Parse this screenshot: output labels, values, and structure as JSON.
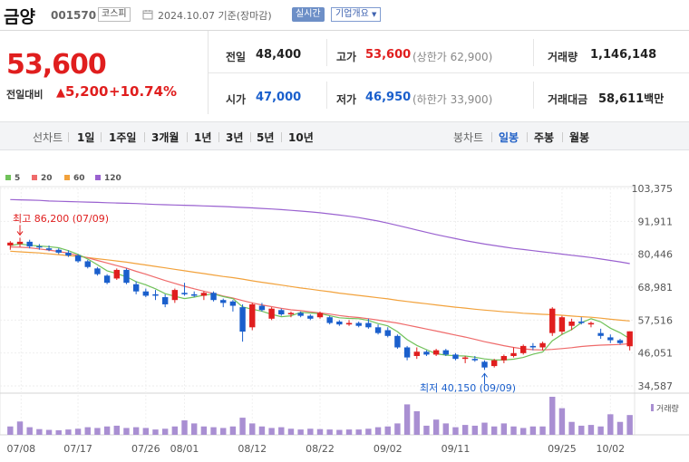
{
  "header": {
    "stock_name": "금양",
    "stock_code": "001570",
    "market": "코스피",
    "date": "2024.10.07 기준(장마감)",
    "realtime_label": "실시간",
    "company_label": "기업개요"
  },
  "price": {
    "current": "53,600",
    "change_label": "전일대비",
    "change_amount": "5,200",
    "change_percent": "+10.74%"
  },
  "stats": {
    "prev_close_label": "전일",
    "prev_close": "48,400",
    "high_label": "고가",
    "high": "53,600",
    "upper_limit": "(상한가 62,900)",
    "volume_label": "거래량",
    "volume": "1,146,148",
    "open_label": "시가",
    "open": "47,000",
    "low_label": "저가",
    "low": "46,950",
    "lower_limit": "(하한가 33,900)",
    "amount_label": "거래대금",
    "amount": "58,611",
    "amount_unit": "백만"
  },
  "toolbar": {
    "line_chart_label": "선차트",
    "periods": [
      "1일",
      "1주일",
      "3개월",
      "1년",
      "3년",
      "5년",
      "10년"
    ],
    "candle_label": "봉차트",
    "candles": [
      "일봉",
      "주봉",
      "월봉"
    ],
    "active_candle": "일봉"
  },
  "colors": {
    "up": "#e01e1e",
    "down": "#1a5fcc",
    "ma5": "#70c25a",
    "ma20": "#ef6b6b",
    "ma60": "#f2a23c",
    "ma120": "#9a62d0",
    "volume": "#a98fd2"
  },
  "chart_data": {
    "type": "candlestick",
    "legend": [
      "5",
      "20",
      "60",
      "120"
    ],
    "y_ticks": [
      "103,375",
      "91,911",
      "80,446",
      "68,981",
      "57,516",
      "46,051",
      "34,587"
    ],
    "ylim": [
      34587,
      103375
    ],
    "x_ticks": [
      "07/08",
      "07/17",
      "07/26",
      "08/01",
      "08/12",
      "08/22",
      "09/02",
      "09/11",
      "09/25",
      "10/02"
    ],
    "volume_label": "거래량",
    "annotations": {
      "high": {
        "label": "최고 86,200 (07/09)",
        "value": 86200,
        "index": 1
      },
      "low": {
        "label": "최저 40,150 (09/09)",
        "value": 40150,
        "index": 49
      }
    },
    "candles": [
      {
        "o": 83500,
        "h": 85000,
        "l": 82000,
        "c": 84500
      },
      {
        "o": 84000,
        "h": 86200,
        "l": 83000,
        "c": 84800
      },
      {
        "o": 84800,
        "h": 85500,
        "l": 82500,
        "c": 83200
      },
      {
        "o": 83200,
        "h": 84000,
        "l": 82000,
        "c": 82800
      },
      {
        "o": 82500,
        "h": 83500,
        "l": 81500,
        "c": 82000
      },
      {
        "o": 82000,
        "h": 82500,
        "l": 80500,
        "c": 81000
      },
      {
        "o": 81000,
        "h": 81800,
        "l": 79500,
        "c": 80000
      },
      {
        "o": 80000,
        "h": 80500,
        "l": 77500,
        "c": 78000
      },
      {
        "o": 78000,
        "h": 78500,
        "l": 75500,
        "c": 76000
      },
      {
        "o": 75500,
        "h": 76000,
        "l": 73000,
        "c": 73500
      },
      {
        "o": 73000,
        "h": 73500,
        "l": 70000,
        "c": 70500
      },
      {
        "o": 72000,
        "h": 75500,
        "l": 71500,
        "c": 75000
      },
      {
        "o": 75000,
        "h": 75500,
        "l": 70000,
        "c": 70500
      },
      {
        "o": 70000,
        "h": 71000,
        "l": 66500,
        "c": 67500
      },
      {
        "o": 67500,
        "h": 68500,
        "l": 65500,
        "c": 66000
      },
      {
        "o": 66500,
        "h": 68000,
        "l": 64500,
        "c": 66000
      },
      {
        "o": 65500,
        "h": 66500,
        "l": 62000,
        "c": 63000
      },
      {
        "o": 64500,
        "h": 68500,
        "l": 63500,
        "c": 68000
      },
      {
        "o": 67000,
        "h": 70500,
        "l": 66000,
        "c": 66500
      },
      {
        "o": 66500,
        "h": 67500,
        "l": 65500,
        "c": 66000
      },
      {
        "o": 66000,
        "h": 67500,
        "l": 64500,
        "c": 67000
      },
      {
        "o": 67000,
        "h": 67500,
        "l": 64000,
        "c": 64500
      },
      {
        "o": 64500,
        "h": 65000,
        "l": 62000,
        "c": 63500
      },
      {
        "o": 64000,
        "h": 64500,
        "l": 60500,
        "c": 62500
      },
      {
        "o": 62000,
        "h": 63000,
        "l": 50000,
        "c": 53500
      },
      {
        "o": 55000,
        "h": 63500,
        "l": 54000,
        "c": 63000
      },
      {
        "o": 62500,
        "h": 63500,
        "l": 60500,
        "c": 61000
      },
      {
        "o": 58000,
        "h": 62000,
        "l": 57500,
        "c": 61500
      },
      {
        "o": 61000,
        "h": 61500,
        "l": 59000,
        "c": 59500
      },
      {
        "o": 59500,
        "h": 60500,
        "l": 58500,
        "c": 60000
      },
      {
        "o": 60000,
        "h": 60500,
        "l": 58500,
        "c": 59000
      },
      {
        "o": 59000,
        "h": 59500,
        "l": 57500,
        "c": 58000
      },
      {
        "o": 58500,
        "h": 60500,
        "l": 58000,
        "c": 60000
      },
      {
        "o": 58500,
        "h": 59000,
        "l": 56000,
        "c": 56500
      },
      {
        "o": 57000,
        "h": 57500,
        "l": 55500,
        "c": 56000
      },
      {
        "o": 56000,
        "h": 57500,
        "l": 55500,
        "c": 56500
      },
      {
        "o": 56500,
        "h": 57000,
        "l": 55000,
        "c": 55500
      },
      {
        "o": 56500,
        "h": 58000,
        "l": 54500,
        "c": 55000
      },
      {
        "o": 55000,
        "h": 56000,
        "l": 52500,
        "c": 53000
      },
      {
        "o": 54000,
        "h": 55000,
        "l": 51500,
        "c": 52000
      },
      {
        "o": 52000,
        "h": 52500,
        "l": 47500,
        "c": 48000
      },
      {
        "o": 48000,
        "h": 48500,
        "l": 43500,
        "c": 44500
      },
      {
        "o": 45000,
        "h": 48000,
        "l": 44000,
        "c": 46500
      },
      {
        "o": 46500,
        "h": 47000,
        "l": 45000,
        "c": 45500
      },
      {
        "o": 45500,
        "h": 47500,
        "l": 45000,
        "c": 47000
      },
      {
        "o": 47000,
        "h": 47500,
        "l": 45000,
        "c": 45500
      },
      {
        "o": 45500,
        "h": 46000,
        "l": 43500,
        "c": 44000
      },
      {
        "o": 44000,
        "h": 45000,
        "l": 42500,
        "c": 44500
      },
      {
        "o": 44000,
        "h": 45000,
        "l": 43000,
        "c": 43500
      },
      {
        "o": 43000,
        "h": 43500,
        "l": 40150,
        "c": 41000
      },
      {
        "o": 41500,
        "h": 44000,
        "l": 41000,
        "c": 43500
      },
      {
        "o": 43500,
        "h": 45500,
        "l": 42500,
        "c": 45000
      },
      {
        "o": 45000,
        "h": 48000,
        "l": 44500,
        "c": 46000
      },
      {
        "o": 46000,
        "h": 49000,
        "l": 45500,
        "c": 48500
      },
      {
        "o": 48500,
        "h": 49500,
        "l": 47000,
        "c": 48000
      },
      {
        "o": 48000,
        "h": 50000,
        "l": 47000,
        "c": 49500
      },
      {
        "o": 53000,
        "h": 62000,
        "l": 52000,
        "c": 61500
      },
      {
        "o": 53500,
        "h": 59000,
        "l": 52500,
        "c": 58500
      },
      {
        "o": 55500,
        "h": 58000,
        "l": 54000,
        "c": 57000
      },
      {
        "o": 57000,
        "h": 58500,
        "l": 56000,
        "c": 56500
      },
      {
        "o": 56000,
        "h": 57000,
        "l": 55000,
        "c": 56500
      },
      {
        "o": 53000,
        "h": 54500,
        "l": 51000,
        "c": 52000
      },
      {
        "o": 51500,
        "h": 52500,
        "l": 49500,
        "c": 50500
      },
      {
        "o": 50500,
        "h": 51000,
        "l": 49000,
        "c": 49500
      },
      {
        "o": 48400,
        "h": 53600,
        "l": 46950,
        "c": 53600
      }
    ],
    "ma5": [
      83500,
      84000,
      83600,
      83300,
      83100,
      82700,
      81700,
      80400,
      78800,
      76800,
      74700,
      73700,
      72600,
      70900,
      69800,
      68400,
      66700,
      65800,
      65000,
      65500,
      66200,
      66600,
      65700,
      65000,
      62100,
      61300,
      60600,
      59500,
      58700,
      59000,
      60200,
      60000,
      59800,
      59000,
      58300,
      58100,
      58000,
      57400,
      56300,
      55500,
      53500,
      50700,
      48700,
      47200,
      45800,
      45300,
      45100,
      45000,
      44600,
      44000,
      43600,
      43600,
      43900,
      44500,
      45600,
      46400,
      50300,
      52500,
      54200,
      56600,
      58000,
      56900,
      54700,
      53100,
      51000
    ],
    "ma20": [
      83000,
      82900,
      82700,
      82300,
      81900,
      81400,
      80800,
      80000,
      79200,
      78300,
      77400,
      76500,
      75600,
      74500,
      73500,
      72400,
      71300,
      70300,
      69300,
      68400,
      67600,
      66800,
      65900,
      65200,
      64300,
      63500,
      62800,
      62200,
      61600,
      61100,
      60800,
      60400,
      60000,
      59600,
      59100,
      58700,
      58400,
      58000,
      57500,
      57000,
      56500,
      55800,
      55100,
      54400,
      53700,
      53000,
      52300,
      51600,
      50800,
      50000,
      49300,
      48600,
      48000,
      47500,
      47200,
      47100,
      47300,
      47600,
      47900,
      48300,
      48600,
      48800,
      48900,
      49000,
      49300
    ],
    "ma60": [
      81500,
      81300,
      81100,
      80900,
      80600,
      80300,
      80000,
      79700,
      79300,
      78900,
      78500,
      78100,
      77700,
      77200,
      76700,
      76200,
      75700,
      75200,
      74700,
      74200,
      73700,
      73200,
      72700,
      72300,
      71800,
      71200,
      70700,
      70200,
      69700,
      69200,
      68700,
      68300,
      67800,
      67400,
      66900,
      66500,
      66100,
      65700,
      65300,
      64900,
      64400,
      64000,
      63600,
      63200,
      62800,
      62400,
      62000,
      61700,
      61300,
      61000,
      60700,
      60400,
      60200,
      59900,
      59700,
      59500,
      59400,
      59200,
      58900,
      58700,
      58500,
      58200,
      57800,
      57500,
      57200
    ],
    "ma120": [
      99500,
      99400,
      99300,
      99200,
      99000,
      98900,
      98800,
      98700,
      98600,
      98500,
      98400,
      98300,
      98200,
      98100,
      97950,
      97800,
      97700,
      97600,
      97500,
      97400,
      97300,
      97200,
      97050,
      96900,
      96750,
      96600,
      96400,
      96200,
      96000,
      95750,
      95500,
      95200,
      94900,
      94500,
      94100,
      93700,
      93200,
      92600,
      92000,
      91300,
      90500,
      89700,
      88900,
      88100,
      87300,
      86600,
      85900,
      85200,
      84600,
      84000,
      83500,
      83000,
      82500,
      82100,
      81700,
      81300,
      80900,
      80500,
      80100,
      79700,
      79300,
      78800,
      78300,
      77800,
      77200
    ],
    "volume": [
      0.22,
      0.35,
      0.2,
      0.15,
      0.13,
      0.12,
      0.14,
      0.16,
      0.2,
      0.18,
      0.22,
      0.24,
      0.18,
      0.2,
      0.18,
      0.14,
      0.16,
      0.22,
      0.38,
      0.3,
      0.22,
      0.2,
      0.18,
      0.22,
      0.45,
      0.3,
      0.22,
      0.18,
      0.2,
      0.16,
      0.14,
      0.16,
      0.15,
      0.14,
      0.13,
      0.14,
      0.14,
      0.16,
      0.2,
      0.22,
      0.3,
      0.8,
      0.62,
      0.24,
      0.4,
      0.3,
      0.2,
      0.26,
      0.24,
      0.32,
      0.22,
      0.3,
      0.22,
      0.18,
      0.22,
      0.22,
      1.0,
      0.7,
      0.34,
      0.24,
      0.26,
      0.22,
      0.54,
      0.34,
      0.52
    ]
  }
}
